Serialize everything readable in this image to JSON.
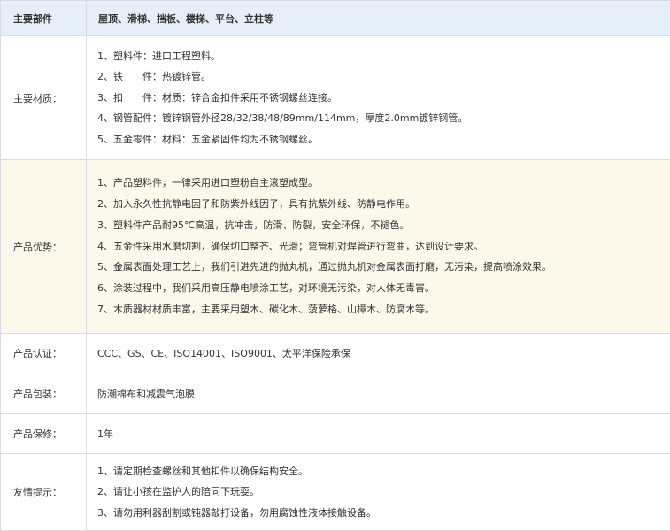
{
  "header": {
    "key": "主要部件",
    "value": "屋顶、滑梯、挡板、楼梯、平台、立柱等"
  },
  "materials": {
    "label": "主要材质：",
    "items": [
      "1、塑料件：进口工程塑料。",
      "2、铁　　件：热镀锌管。",
      "3、扣　　件：材质：锌合金扣件采用不锈钢螺丝连接。",
      "4、钢管配件：镀锌钢管外径28/32/38/48/89mm/114mm，厚度2.0mm镀锌钢管。",
      "5、五金零件：材料：五金紧固件均为不锈钢螺丝。"
    ]
  },
  "advantages": {
    "label": "产品优势：",
    "items": [
      "1、产品塑料件，一律采用进口塑粉自主滚塑成型。",
      "2、加入永久性抗静电因子和防紫外线因子，具有抗紫外线、防静电作用。",
      "3、塑料件产品耐95℃高温，抗冲击，防滑、防裂，安全环保，不褪色。",
      "4、五金件采用水磨切割，确保切口整齐、光滑；弯管机对焊管进行弯曲，达到设计要求。",
      "5、金属表面处理工艺上，我们引进先进的抛丸机，通过抛丸机对金属表面打磨，无污染，提高喷涂效果。",
      "6、涂装过程中，我们采用高压静电喷涂工艺，对环境无污染，对人体无毒害。",
      "7、木质器材材质丰富，主要采用塑木、碳化木、菠萝格、山樟木、防腐木等。"
    ]
  },
  "certification": {
    "label": "产品认证：",
    "value": "CCC、GS、CE、ISO14001、ISO9001、太平洋保险承保"
  },
  "packaging": {
    "label": "产品包装：",
    "value": "防潮棉布和减震气泡膜"
  },
  "warranty": {
    "label": "产品保修：",
    "value": "1年"
  },
  "tips": {
    "label": "友情提示：",
    "items": [
      "1、请定期检查螺丝和其他扣件以确保结构安全。",
      "2、请让小孩在监护人的陪同下玩耍。",
      "3、请勿用利器刮割或钝器敲打设备，勿用腐蚀性液体接触设备。"
    ]
  }
}
